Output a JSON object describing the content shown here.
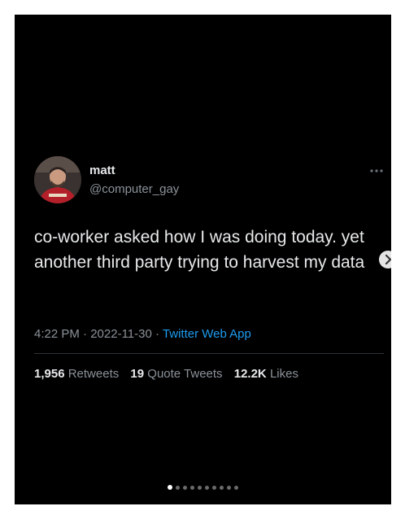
{
  "tweet": {
    "display_name": "matt",
    "handle": "@computer_gay",
    "more_icon": "more-horizontal-icon",
    "text": "co-worker asked how I was doing today. yet another third party trying to harvest my data",
    "time": "4:22 PM",
    "separator": " · ",
    "date": "2022-11-30",
    "source": "Twitter Web App",
    "stats": {
      "retweets_count": "1,956",
      "retweets_label": "Retweets",
      "quotes_count": "19",
      "quotes_label": "Quote Tweets",
      "likes_count": "12.2K",
      "likes_label": "Likes"
    }
  },
  "carousel": {
    "next_icon": "chevron-right-icon",
    "page_count": 10,
    "active_index": 0
  },
  "colors": {
    "background": "#000000",
    "text": "#e7e9ea",
    "muted": "#8b9299",
    "link": "#1d9bf0"
  }
}
